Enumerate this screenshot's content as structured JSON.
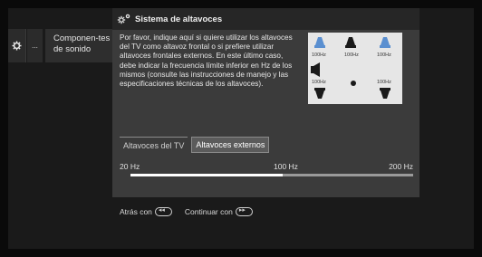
{
  "sidebar": {
    "ellipsis": "...",
    "item_label": "Componen-tes de sonido"
  },
  "dialog": {
    "title": "Sistema de altavoces",
    "description": "Por favor, indique aquí si quiere utilizar los altavoces del TV como altavoz frontal o si prefiere utilizar altavoces frontales externos. En este último caso, debe indicar la frecuencia límite inferior en Hz de los mismos (consulte las instrucciones de manejo y las especificaciones técnicas de los altavoces).",
    "diagram_labels": {
      "front_left": "100Hz",
      "center": "100Hz",
      "front_right": "100Hz",
      "rear_left": "100Hz",
      "rear_right": "100Hz"
    },
    "tabs": [
      {
        "label": "Altavoces del TV",
        "active": false
      },
      {
        "label": "Altavoces externos",
        "active": true
      }
    ],
    "scale": {
      "min_label": "20 Hz",
      "mid_label": "100 Hz",
      "max_label": "200 Hz",
      "value_fraction": 0.54
    }
  },
  "footer": {
    "back": "Atrás con",
    "continue": "Continuar con"
  },
  "colors": {
    "speaker_accent": "#5a8fd0",
    "speaker_dark": "#1a1a1a"
  }
}
